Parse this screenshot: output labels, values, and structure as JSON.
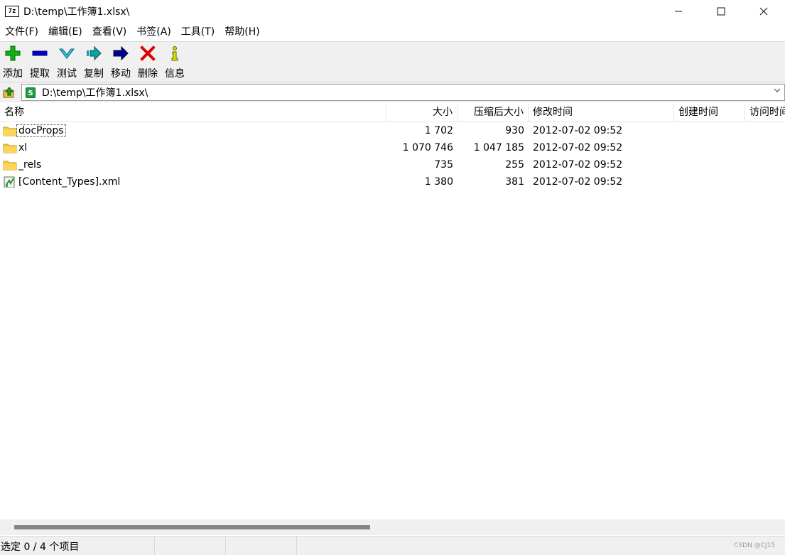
{
  "window": {
    "app_icon_text": "7z",
    "title": "D:\\temp\\工作簿1.xlsx\\",
    "controls": {
      "minimize": "—",
      "maximize": "☐",
      "close": "✕"
    }
  },
  "menu": [
    "文件(F)",
    "编辑(E)",
    "查看(V)",
    "书签(A)",
    "工具(T)",
    "帮助(H)"
  ],
  "toolbar": [
    {
      "label": "添加",
      "icon": "add-icon",
      "color": "#00a000"
    },
    {
      "label": "提取",
      "icon": "extract-icon",
      "color": "#0000c0"
    },
    {
      "label": "测试",
      "icon": "test-icon",
      "color": "#00a0c0"
    },
    {
      "label": "复制",
      "icon": "copy-icon",
      "color": "#008080"
    },
    {
      "label": "移动",
      "icon": "move-icon",
      "color": "#000080"
    },
    {
      "label": "删除",
      "icon": "delete-icon",
      "color": "#e00000"
    },
    {
      "label": "信息",
      "icon": "info-icon",
      "color": "#c0c000"
    }
  ],
  "address": {
    "path": "D:\\temp\\工作簿1.xlsx\\",
    "file_icon_letter": "S"
  },
  "columns": {
    "name": "名称",
    "size": "大小",
    "packed": "压缩后大小",
    "modified": "修改时间",
    "created": "创建时间",
    "accessed": "访问时间"
  },
  "rows": [
    {
      "name": "docProps",
      "type": "folder",
      "size": "1 702",
      "packed": "930",
      "modified": "2012-07-02 09:52"
    },
    {
      "name": "xl",
      "type": "folder",
      "size": "1 070 746",
      "packed": "1 047 185",
      "modified": "2012-07-02 09:52"
    },
    {
      "name": "_rels",
      "type": "folder",
      "size": "735",
      "packed": "255",
      "modified": "2012-07-02 09:52"
    },
    {
      "name": "[Content_Types].xml",
      "type": "file",
      "size": "1 380",
      "packed": "381",
      "modified": "2012-07-02 09:52"
    }
  ],
  "status": {
    "selection": "选定 0 / 4 个项目",
    "watermark": "CSDN @CJ15"
  }
}
